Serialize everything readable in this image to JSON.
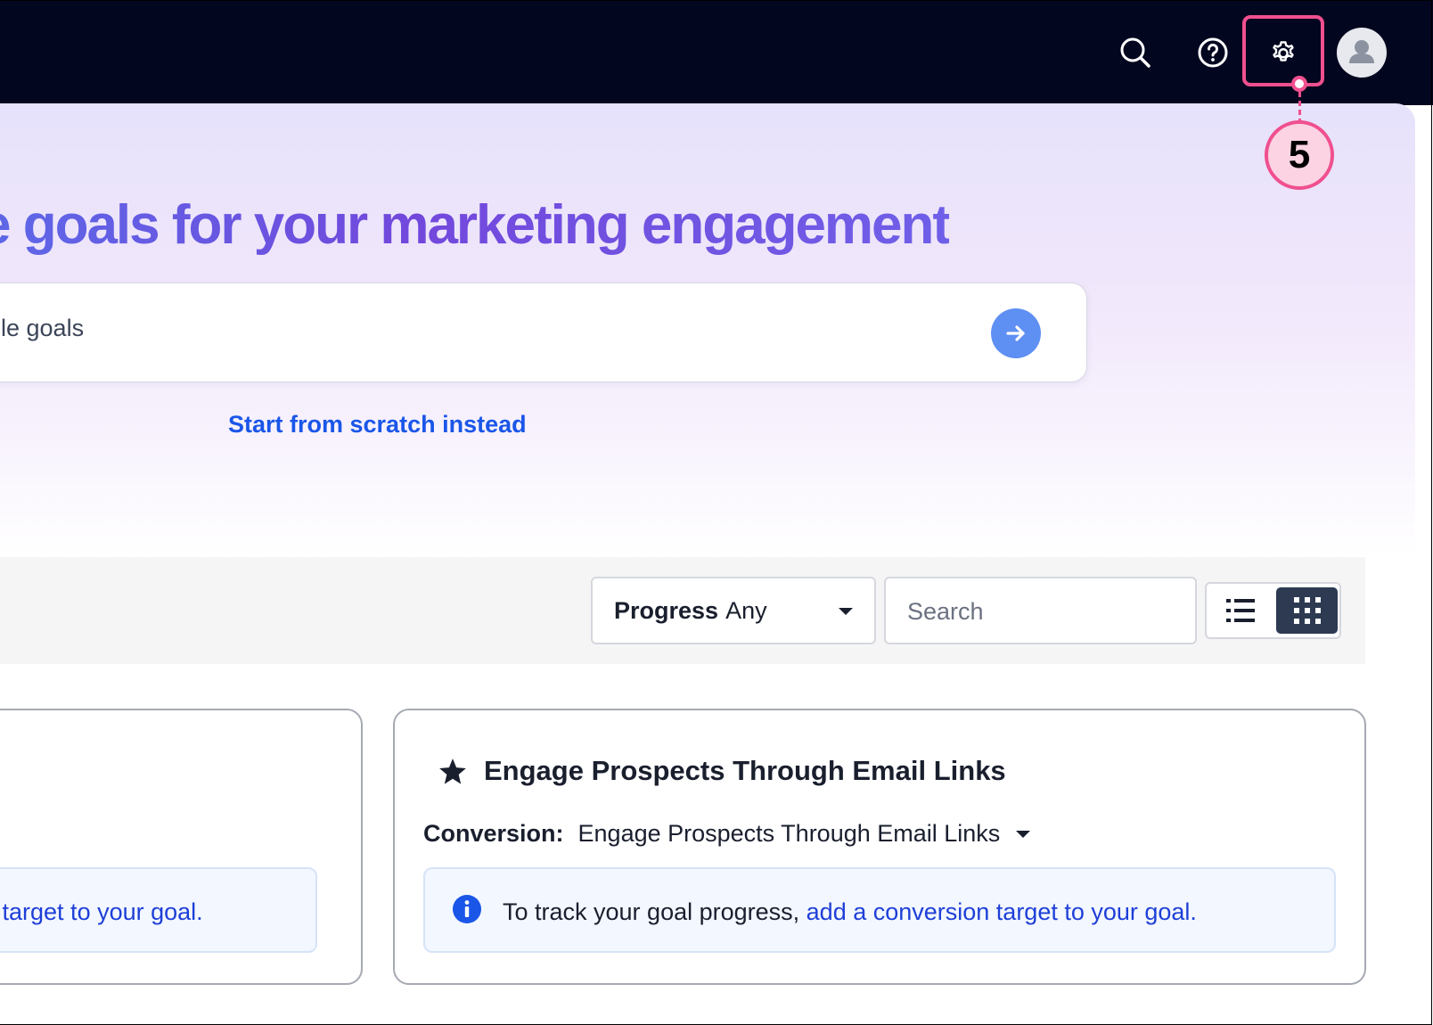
{
  "topbar": {
    "icons": [
      "search-icon",
      "help-icon",
      "gear-icon",
      "avatar-icon"
    ]
  },
  "callout": {
    "number": "5",
    "color": "#f0508f"
  },
  "hero": {
    "title": "e goals for your marketing engagement",
    "prompt_placeholder": "le goals",
    "scratch_link": "Start from scratch instead"
  },
  "filters": {
    "progress_label": "Progress",
    "progress_value": "Any",
    "search_placeholder": "Search",
    "view_modes": [
      "list",
      "grid"
    ],
    "active_view": "grid"
  },
  "cards": {
    "left": {
      "info_link": "n target to your goal."
    },
    "right": {
      "title": "Engage Prospects Through Email Links",
      "conversion_label": "Conversion:",
      "conversion_value": "Engage Prospects Through Email Links",
      "info_text": "To track your goal progress, ",
      "info_link": "add a conversion target to your goal."
    }
  },
  "colors": {
    "topbar": "#03061f",
    "accent_blue": "#1a56e8",
    "send_button": "#5e8ff3",
    "grid_toggle_active": "#2d3a52"
  }
}
